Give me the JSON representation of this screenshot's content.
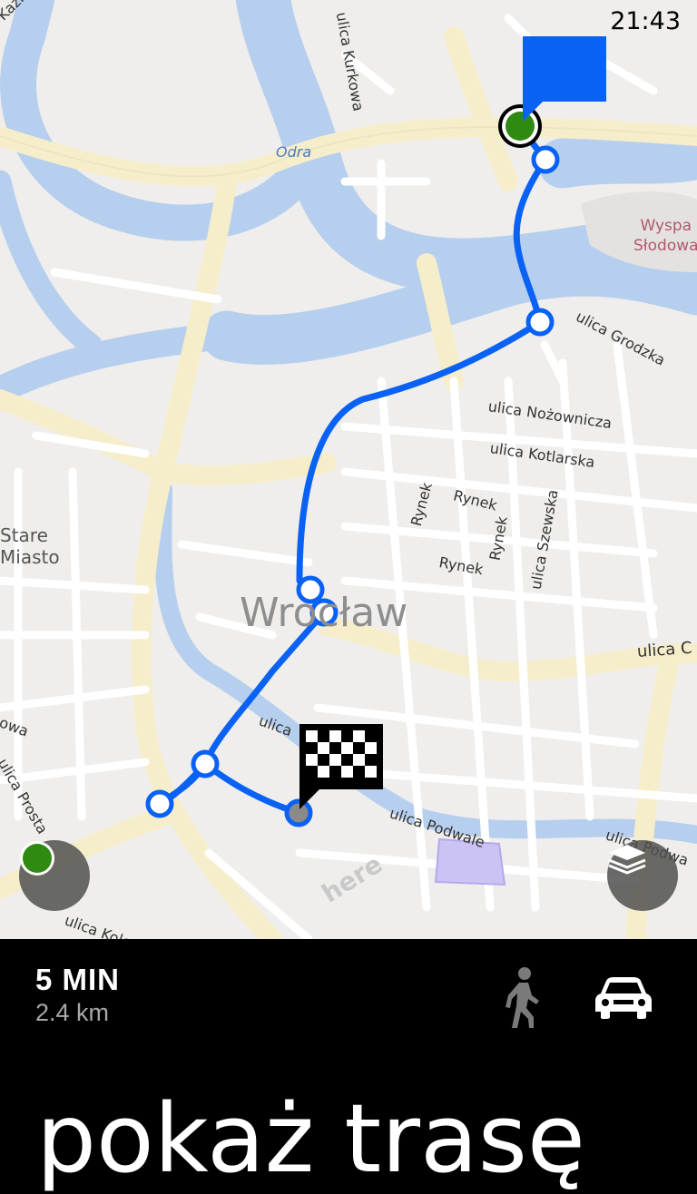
{
  "status_bar": {
    "time": "21:43"
  },
  "map": {
    "street_labels": {
      "kazim": "Kazim",
      "kurkowa": "ulica Kurkowa",
      "grodzka": "ulica Grodzka",
      "nozownicza": "ulica Nożownicza",
      "kotlarska": "ulica Kotlarska",
      "rynek_1": "Rynek",
      "rynek_2": "Rynek",
      "rynek_3": "Rynek",
      "szewska": "ulica Szewska",
      "ulica_right": "ulica C",
      "ulica_mid": "ulica",
      "owa": "owa",
      "prosta": "ulica Prosta",
      "podwale": "ulica Podwale",
      "podwale_right": "ulica Podwa",
      "kole": "ulica Kole"
    },
    "river_label": "Odra",
    "island_label_line1": "Wyspa",
    "island_label_line2": "Słodowa",
    "district_line1": "Stare",
    "district_line2": "Miasto",
    "city_label": "Wrocław",
    "provider_mark": "here",
    "colors": {
      "water": "#b7cfee",
      "major_road": "#f6eecb",
      "minor_road": "#ffffff",
      "route": "#0a62f5",
      "start_marker": "#2f8a12",
      "flag": "#0a62f5"
    }
  },
  "controls": {
    "locate_icon": "current-location-icon",
    "layers_icon": "map-layers-icon"
  },
  "route_summary": {
    "duration": "5 MIN",
    "distance": "2.4 km",
    "walk_icon": "walk-icon",
    "car_icon": "car-icon"
  },
  "action": {
    "title": "pokaż trasę"
  }
}
